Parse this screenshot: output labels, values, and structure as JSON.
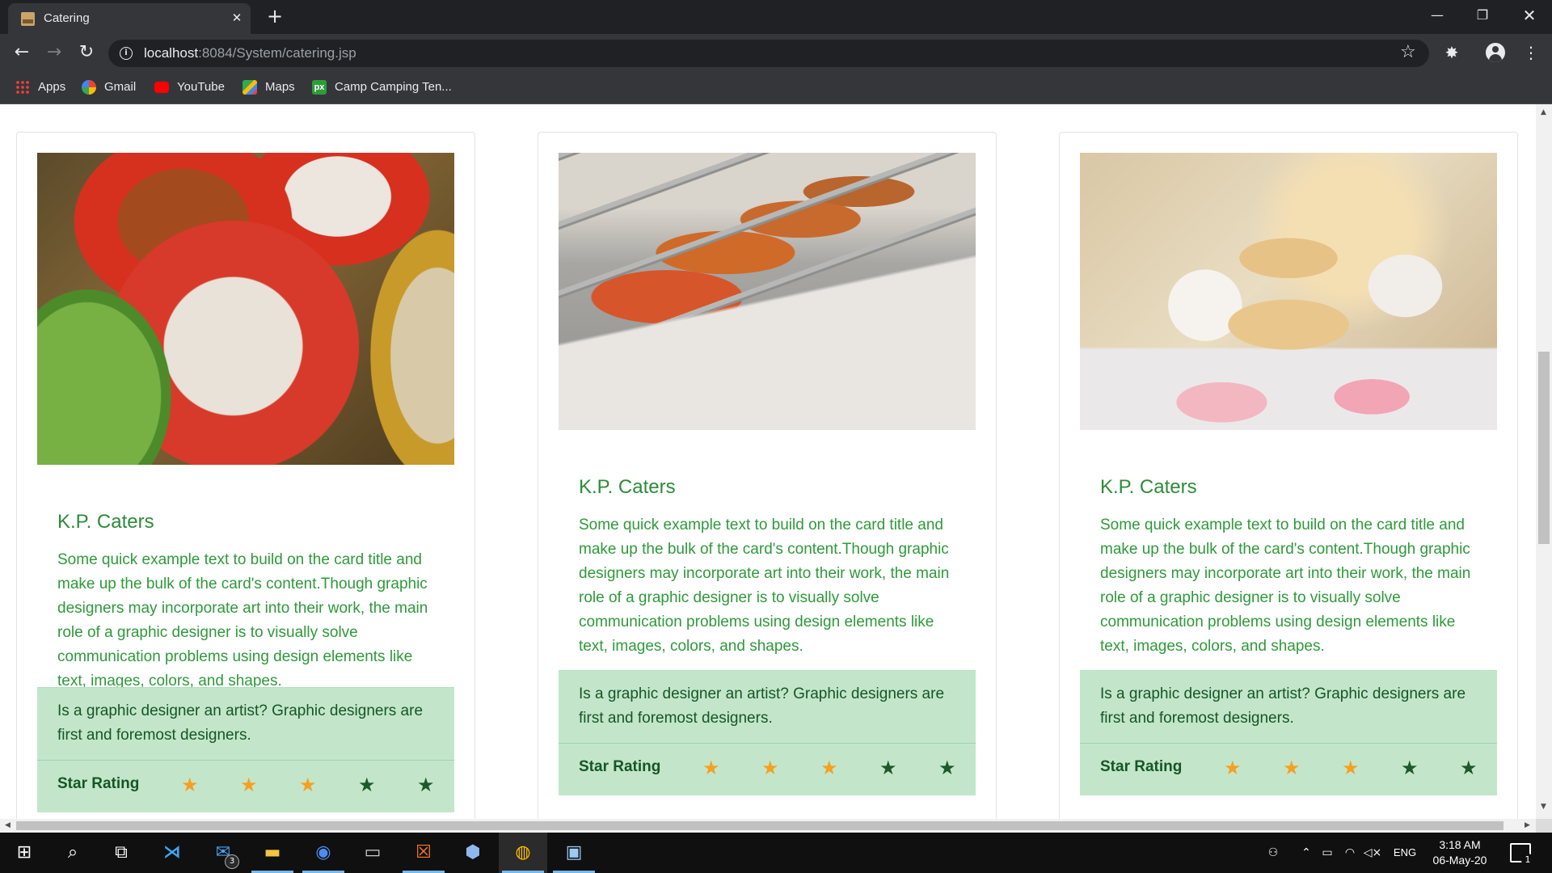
{
  "browser": {
    "tab_title": "Catering",
    "tab_close": "✕",
    "new_tab": "+",
    "url_host": "localhost",
    "url_rest": ":8084/System/catering.jsp",
    "window": {
      "minimize": "—",
      "maximize": "❐",
      "close": "✕"
    },
    "nav": {
      "back": "←",
      "forward": "→",
      "reload": "↻"
    },
    "star": "☆",
    "extension": "✸",
    "menu": "⋮"
  },
  "bookmarks": [
    {
      "label": "Apps",
      "icon": "apps-grid-icon",
      "color": "#ea4335"
    },
    {
      "label": "Gmail",
      "icon": "google-icon",
      "color": "#4285f4"
    },
    {
      "label": "YouTube",
      "icon": "youtube-icon",
      "color": "#ff0000"
    },
    {
      "label": "Maps",
      "icon": "maps-icon",
      "color": "#34a853"
    },
    {
      "label": "Camp Camping Ten...",
      "icon": "px-icon",
      "color": "#2e9c3a"
    }
  ],
  "cards": [
    {
      "title": "K.P. Caters",
      "text": "Some quick example text to build on the card title and make up the bulk of the card's content.Though graphic designers may incorporate art into their work, the main role of a graphic designer is to visually solve communication problems using design elements like text, images, colors, and shapes.",
      "note": "Is a graphic designer an artist? Graphic designers are first and foremost designers.",
      "rating_label": "Star Rating",
      "rating": 3,
      "max_rating": 5
    },
    {
      "title": "K.P. Caters",
      "text": "Some quick example text to build on the card title and make up the bulk of the card's content.Though graphic designers may incorporate art into their work, the main role of a graphic designer is to visually solve communication problems using design elements like text, images, colors, and shapes.",
      "note": "Is a graphic designer an artist? Graphic designers are first and foremost designers.",
      "rating_label": "Star Rating",
      "rating": 3,
      "max_rating": 5
    },
    {
      "title": "K.P. Caters",
      "text": "Some quick example text to build on the card title and make up the bulk of the card's content.Though graphic designers may incorporate art into their work, the main role of a graphic designer is to visually solve communication problems using design elements like text, images, colors, and shapes.",
      "note": "Is a graphic designer an artist? Graphic designers are first and foremost designers.",
      "rating_label": "Star Rating",
      "rating": 3,
      "max_rating": 5
    }
  ],
  "colors": {
    "card_title": "#2e8b3a",
    "note_bg": "#c3e6cb",
    "note_text": "#155724",
    "star_on": "#f5a020",
    "star_off": "#1d5a2a"
  },
  "taskbar": {
    "apps": [
      "windows-start-icon",
      "search-icon",
      "task-view-icon",
      "vscode-icon",
      "mail-icon",
      "file-explorer-icon",
      "firefox-icon",
      "terminal-icon",
      "xampp-icon",
      "3d-box-icon",
      "chrome-icon",
      "photos-icon"
    ],
    "mail_badge": "3",
    "language": "ENG",
    "time": "3:18 AM",
    "date": "06-May-20",
    "notification_count": "1"
  }
}
